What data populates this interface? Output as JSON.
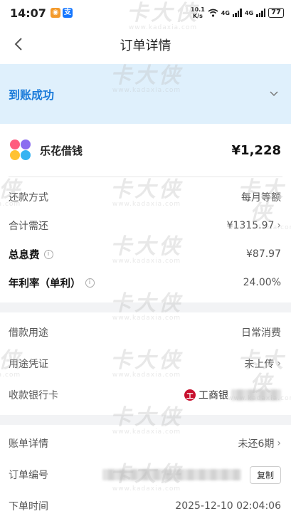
{
  "statusbar": {
    "time": "14:07",
    "net_speed_top": "10.1",
    "net_speed_bottom": "K/s",
    "net1": "4G",
    "net2": "4G",
    "battery": "77"
  },
  "navbar": {
    "title": "订单详情"
  },
  "banner": {
    "status": "到账成功"
  },
  "product": {
    "name": "乐花借钱",
    "amount": "¥1,228"
  },
  "summary": {
    "repay_method_label": "还款方式",
    "repay_method_value": "每月等额",
    "total_label": "合计需还",
    "total_value": "¥1315.97",
    "interest_label": "总息费",
    "interest_value": "¥87.97",
    "rate_label": "年利率（单利）",
    "rate_value": "24.00%"
  },
  "usage": {
    "purpose_label": "借款用途",
    "purpose_value": "日常消费",
    "voucher_label": "用途凭证",
    "voucher_value": "未上传",
    "bank_label": "收款银行卡",
    "bank_value": "工商银"
  },
  "order": {
    "bill_label": "账单详情",
    "bill_value": "未还6期",
    "order_no_label": "订单编号",
    "copy_label": "复制",
    "time_label": "下单时间",
    "time_value": "2025-12-10 02:04:06"
  },
  "watermark": {
    "big": "卡大侠",
    "small": "www.kadaxia.com"
  },
  "colors": {
    "accent": "#1a7ad9",
    "banner_bg": "#dff0fc",
    "bank_red": "#c8102e"
  }
}
